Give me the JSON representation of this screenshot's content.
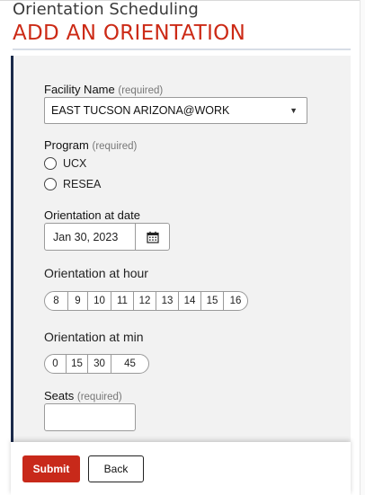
{
  "header": {
    "subtitle": "Orientation Scheduling",
    "title": "ADD AN ORIENTATION"
  },
  "facility": {
    "label": "Facility Name",
    "required": "(required)",
    "selected": "EAST TUCSON ARIZONA@WORK"
  },
  "program": {
    "label": "Program",
    "required": "(required)",
    "options": [
      "UCX",
      "RESEA"
    ]
  },
  "date": {
    "label": "Orientation at date",
    "value": "Jan 30, 2023"
  },
  "hour": {
    "label": "Orientation at hour",
    "options": [
      "8",
      "9",
      "10",
      "11",
      "12",
      "13",
      "14",
      "15",
      "16"
    ]
  },
  "minute": {
    "label": "Orientation at min",
    "options": [
      "0",
      "15",
      "30",
      "45"
    ]
  },
  "seats": {
    "label": "Seats",
    "required": "(required)",
    "value": ""
  },
  "footer": {
    "submit_label": "Submit",
    "back_label": "Back"
  },
  "colors": {
    "accent_red": "#cc2a16",
    "panel_bg": "#f2f2f2",
    "panel_accent": "#1b2a4a"
  },
  "icons": {
    "calendar": "calendar-icon",
    "dropdown": "chevron-down-icon"
  }
}
